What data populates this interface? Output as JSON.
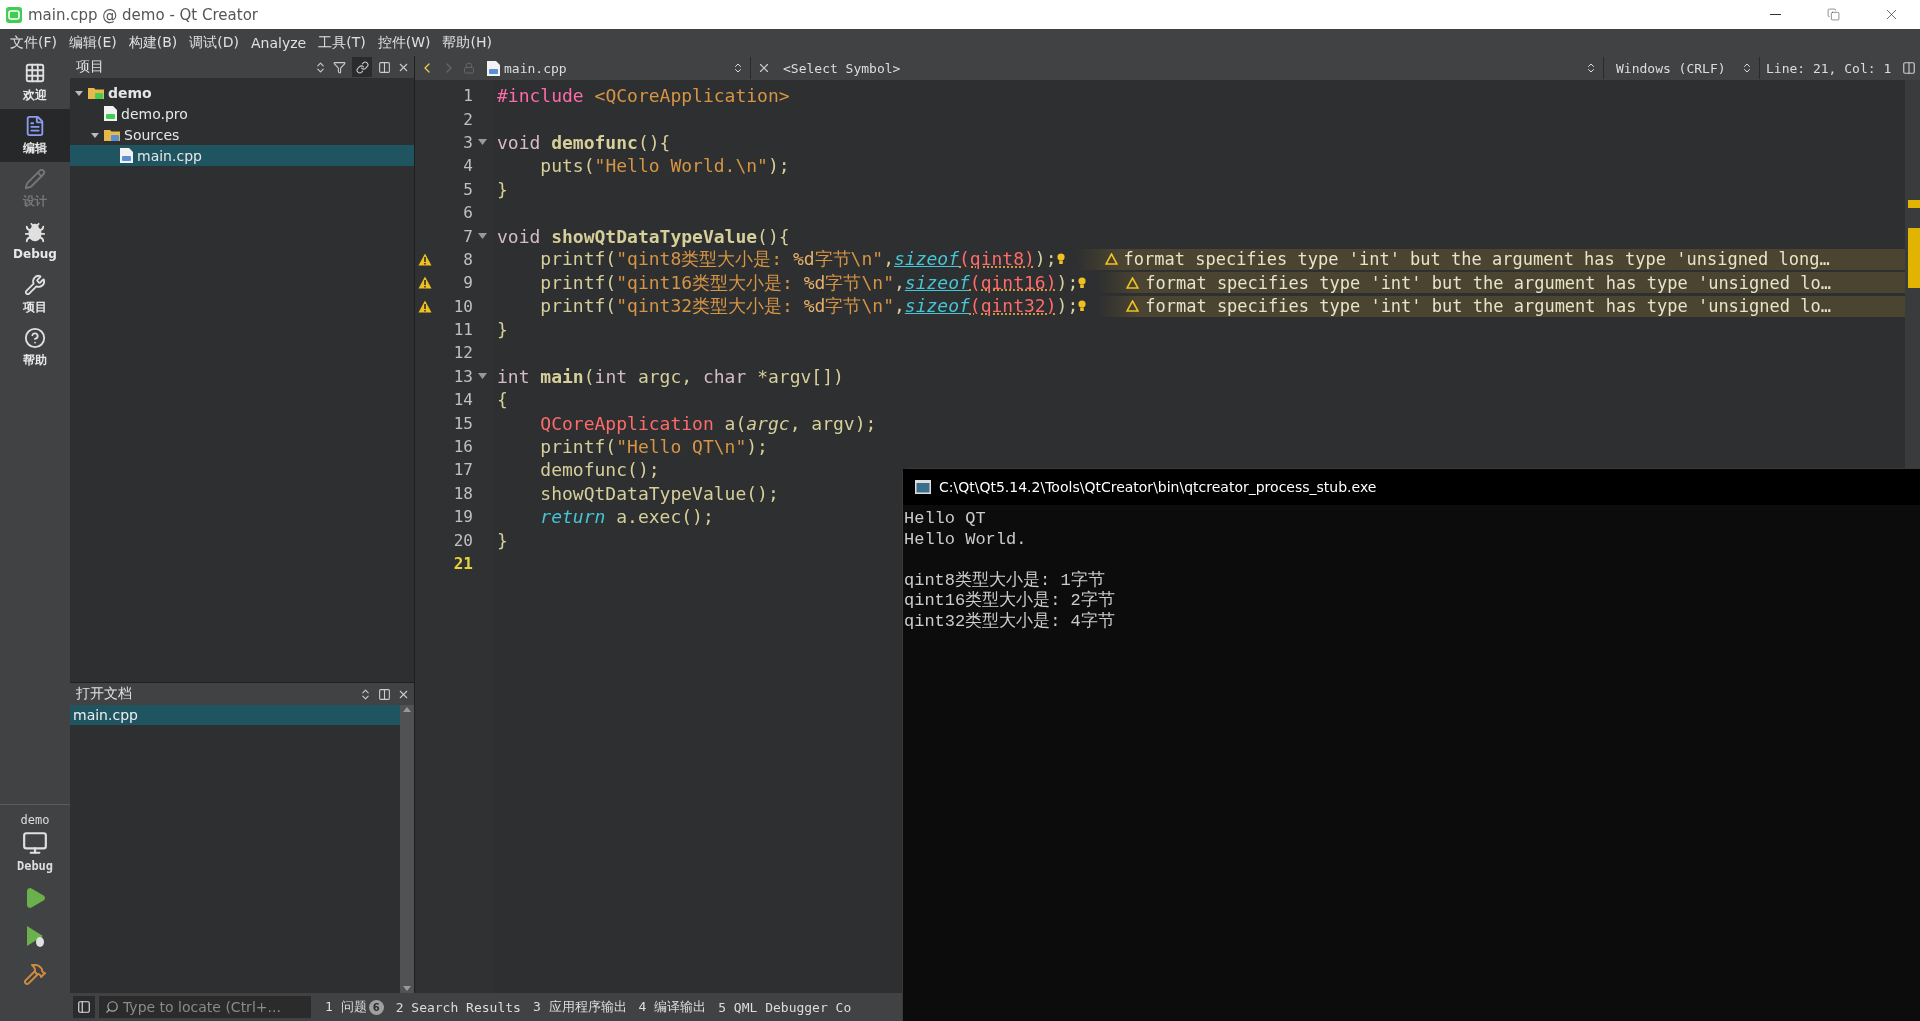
{
  "window": {
    "title": "main.cpp @ demo - Qt Creator"
  },
  "menu": [
    "文件(F)",
    "编辑(E)",
    "构建(B)",
    "调试(D)",
    "Analyze",
    "工具(T)",
    "控件(W)",
    "帮助(H)"
  ],
  "modes": [
    {
      "label": "欢迎",
      "selected": false,
      "disabled": false
    },
    {
      "label": "编辑",
      "selected": true,
      "disabled": false
    },
    {
      "label": "设计",
      "selected": false,
      "disabled": true
    },
    {
      "label": "Debug",
      "selected": false,
      "disabled": false
    },
    {
      "label": "项目",
      "selected": false,
      "disabled": false
    },
    {
      "label": "帮助",
      "selected": false,
      "disabled": false
    }
  ],
  "kit": {
    "project": "demo",
    "build": "Debug"
  },
  "project_panel": {
    "title": "项目",
    "tree": [
      {
        "label": "demo",
        "kind": "project",
        "expanded": true,
        "selected": false,
        "children": [
          {
            "label": "demo.pro",
            "kind": "pro",
            "selected": false
          },
          {
            "label": "Sources",
            "kind": "folder",
            "expanded": true,
            "selected": false,
            "children": [
              {
                "label": "main.cpp",
                "kind": "cpp",
                "selected": true
              }
            ]
          }
        ]
      }
    ]
  },
  "open_documents": {
    "title": "打开文档",
    "items": [
      {
        "label": "main.cpp",
        "selected": true
      }
    ]
  },
  "editor": {
    "file": "main.cpp",
    "symbol": "<Select Symbol>",
    "line_ending": "Windows (CRLF)",
    "position": "Line: 21, Col: 1",
    "lines": [
      {
        "number": "1",
        "fold": false,
        "warning": false,
        "current": false,
        "tokens": [
          {
            "kind": "preprocessor",
            "text": "#include"
          },
          {
            "kind": "include",
            "text": " <QCoreApplication>"
          }
        ]
      },
      {
        "number": "2",
        "fold": false,
        "warning": false,
        "current": false
      },
      {
        "number": "3",
        "fold": true,
        "warning": false,
        "current": false,
        "tokens": [
          {
            "kind": "keyword",
            "text": "void "
          },
          {
            "kind": "declaration",
            "text": "demofunc"
          },
          {
            "kind": "plain",
            "text": "(){"
          }
        ]
      },
      {
        "number": "4",
        "fold": false,
        "warning": false,
        "current": false,
        "tokens": [
          {
            "kind": "plain",
            "text": "    puts("
          },
          {
            "kind": "string",
            "text": "\"Hello World.\\n\""
          },
          {
            "kind": "plain",
            "text": ");"
          }
        ]
      },
      {
        "number": "5",
        "fold": false,
        "warning": false,
        "current": false,
        "tokens": [
          {
            "kind": "plain",
            "text": "}"
          }
        ]
      },
      {
        "number": "6",
        "fold": false,
        "warning": false,
        "current": false
      },
      {
        "number": "7",
        "fold": true,
        "warning": false,
        "current": false,
        "tokens": [
          {
            "kind": "keyword",
            "text": "void "
          },
          {
            "kind": "declaration",
            "text": "showQtDataTypeValue"
          },
          {
            "kind": "plain",
            "text": "(){"
          }
        ]
      },
      {
        "number": "8",
        "fold": false,
        "warning": true,
        "current": false,
        "annotation": "format specifies type 'int' but the argument has type 'unsigned long…",
        "tokens": [
          {
            "kind": "plain",
            "text": "    printf("
          },
          {
            "kind": "string",
            "text": "\"qint8类型大小是: "
          },
          {
            "kind": "format",
            "text": "%d"
          },
          {
            "kind": "string",
            "text": "字节\\n\""
          },
          {
            "kind": "plain",
            "text": ","
          },
          {
            "kind": "sizeof",
            "text": "sizeof"
          },
          {
            "kind": "argument",
            "text": "(qint8)"
          },
          {
            "kind": "plain",
            "text": ");"
          }
        ]
      },
      {
        "number": "9",
        "fold": false,
        "warning": true,
        "current": false,
        "annotation": "format specifies type 'int' but the argument has type 'unsigned lo…",
        "tokens": [
          {
            "kind": "plain",
            "text": "    printf("
          },
          {
            "kind": "string",
            "text": "\"qint16类型大小是: "
          },
          {
            "kind": "format",
            "text": "%d"
          },
          {
            "kind": "string",
            "text": "字节\\n\""
          },
          {
            "kind": "plain",
            "text": ","
          },
          {
            "kind": "sizeof",
            "text": "sizeof"
          },
          {
            "kind": "argument",
            "text": "(qint16)"
          },
          {
            "kind": "plain",
            "text": ");"
          }
        ]
      },
      {
        "number": "10",
        "fold": false,
        "warning": true,
        "current": false,
        "annotation": "format specifies type 'int' but the argument has type 'unsigned lo…",
        "tokens": [
          {
            "kind": "plain",
            "text": "    printf("
          },
          {
            "kind": "string",
            "text": "\"qint32类型大小是: "
          },
          {
            "kind": "format",
            "text": "%d"
          },
          {
            "kind": "string",
            "text": "字节\\n\""
          },
          {
            "kind": "plain",
            "text": ","
          },
          {
            "kind": "sizeof",
            "text": "sizeof"
          },
          {
            "kind": "argument",
            "text": "(qint32)"
          },
          {
            "kind": "plain",
            "text": ");"
          }
        ]
      },
      {
        "number": "11",
        "fold": false,
        "warning": false,
        "current": false,
        "tokens": [
          {
            "kind": "plain",
            "text": "}"
          }
        ]
      },
      {
        "number": "12",
        "fold": false,
        "warning": false,
        "current": false
      },
      {
        "number": "13",
        "fold": true,
        "warning": false,
        "current": false,
        "tokens": [
          {
            "kind": "keyword",
            "text": "int "
          },
          {
            "kind": "declaration",
            "text": "main"
          },
          {
            "kind": "plain",
            "text": "("
          },
          {
            "kind": "keyword",
            "text": "int"
          },
          {
            "kind": "plain",
            "text": " argc, "
          },
          {
            "kind": "keyword",
            "text": "char"
          },
          {
            "kind": "plain",
            "text": " *argv[])"
          }
        ]
      },
      {
        "number": "14",
        "fold": false,
        "warning": false,
        "current": false,
        "tokens": [
          {
            "kind": "plain",
            "text": "{"
          }
        ]
      },
      {
        "number": "15",
        "fold": false,
        "warning": false,
        "current": false,
        "tokens": [
          {
            "kind": "type",
            "text": "    QCoreApplication"
          },
          {
            "kind": "plain",
            "text": " a("
          },
          {
            "kind": "parameter",
            "text": "argc"
          },
          {
            "kind": "plain",
            "text": ", argv);"
          }
        ]
      },
      {
        "number": "16",
        "fold": false,
        "warning": false,
        "current": false,
        "tokens": [
          {
            "kind": "plain",
            "text": "    printf("
          },
          {
            "kind": "string",
            "text": "\"Hello QT\\n\""
          },
          {
            "kind": "plain",
            "text": ");"
          }
        ]
      },
      {
        "number": "17",
        "fold": false,
        "warning": false,
        "current": false,
        "tokens": [
          {
            "kind": "plain",
            "text": "    demofunc();"
          }
        ]
      },
      {
        "number": "18",
        "fold": false,
        "warning": false,
        "current": false,
        "tokens": [
          {
            "kind": "plain",
            "text": "    showQtDataTypeValue();"
          }
        ]
      },
      {
        "number": "19",
        "fold": false,
        "warning": false,
        "current": false,
        "tokens": [
          {
            "kind": "return",
            "text": "    return"
          },
          {
            "kind": "plain",
            "text": " a.exec();"
          }
        ]
      },
      {
        "number": "20",
        "fold": false,
        "warning": false,
        "current": false,
        "tokens": [
          {
            "kind": "plain",
            "text": "}"
          }
        ]
      },
      {
        "number": "21",
        "fold": false,
        "warning": false,
        "current": true
      }
    ]
  },
  "console": {
    "title": "C:\\Qt\\Qt5.14.2\\Tools\\QtCreator\\bin\\qtcreator_process_stub.exe",
    "blocks": [
      [
        "Hello QT",
        "Hello World."
      ],
      [
        "qint8类型大小是: 1字节",
        "qint16类型大小是: 2字节",
        "qint32类型大小是: 4字节"
      ]
    ]
  },
  "bottom_bar": {
    "locator": {
      "placeholder": "Type to locate (Ctrl+..."
    },
    "panes": [
      {
        "label": "1 问题",
        "badge": "6"
      },
      {
        "label": "2 Search Results"
      },
      {
        "label": "3 应用程序输出"
      },
      {
        "label": "4 编译输出"
      },
      {
        "label": "5 QML Debugger Co"
      }
    ]
  }
}
